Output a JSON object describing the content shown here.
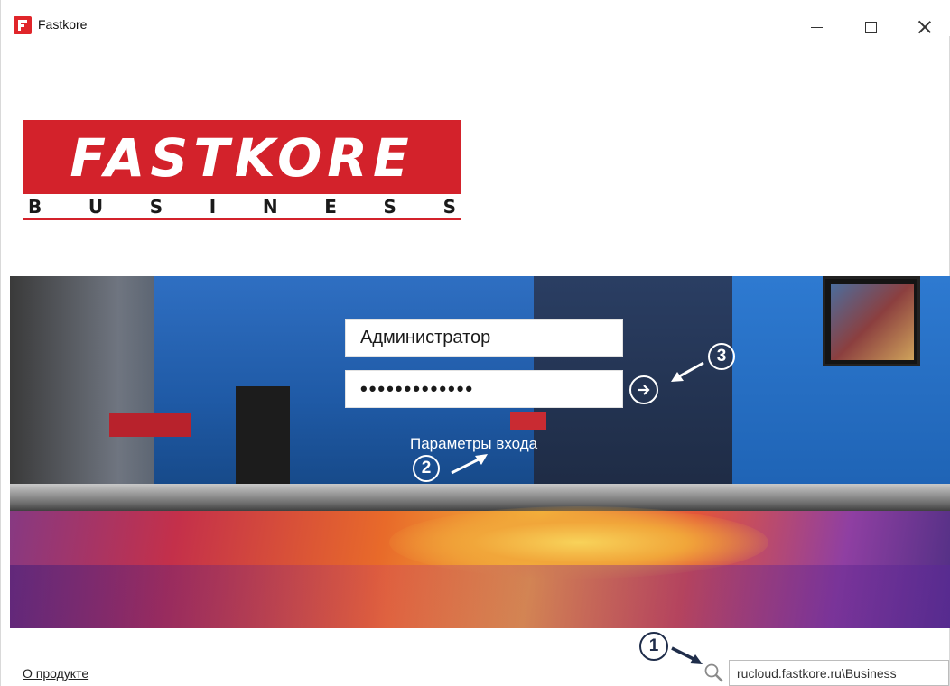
{
  "window": {
    "title": "Fastkore",
    "controls": {
      "minimize": "minimize",
      "maximize": "maximize",
      "close": "close"
    }
  },
  "logo": {
    "main_text": "FASTKORE",
    "sub_letters": [
      "B",
      "U",
      "S",
      "I",
      "N",
      "E",
      "S",
      "S"
    ],
    "brand_color": "#d3222b"
  },
  "login": {
    "username_value": "Администратор",
    "password_value": "•••••••••••••",
    "submit_icon": "arrow-right-circle-icon",
    "options_link": "Параметры входа"
  },
  "annotations": {
    "callout_1": "1",
    "callout_2": "2",
    "callout_3": "3"
  },
  "footer": {
    "about_link": "О продукте",
    "server_icon": "search-icon",
    "server_value": "rucloud.fastkore.ru\\Business"
  }
}
